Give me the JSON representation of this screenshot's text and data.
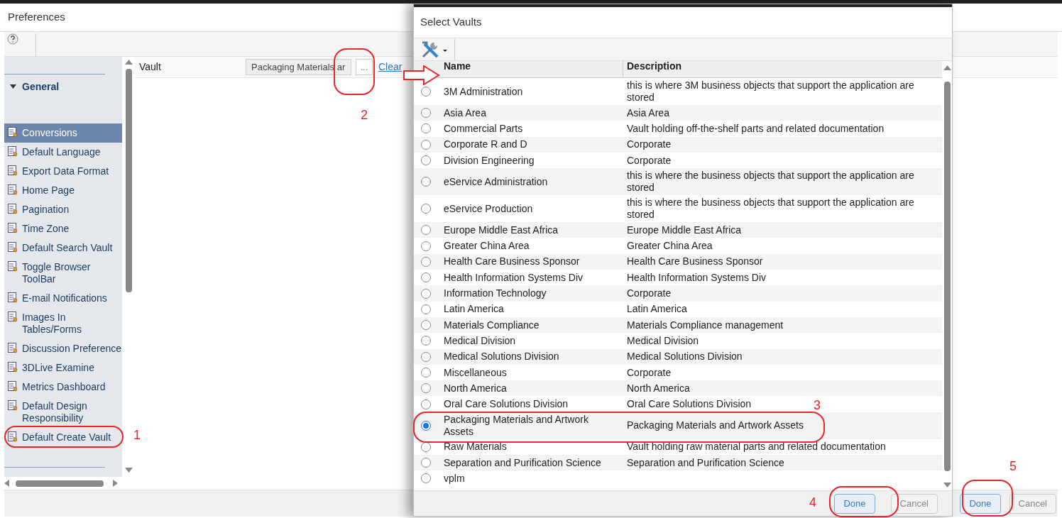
{
  "window": {
    "title": "Preferences"
  },
  "sidebar": {
    "group": {
      "label": "General",
      "expanded": true
    },
    "items": [
      {
        "label": "Conversions",
        "selected": true
      },
      {
        "label": "Default Language",
        "selected": false
      },
      {
        "label": "Export Data Format",
        "selected": false
      },
      {
        "label": "Home Page",
        "selected": false
      },
      {
        "label": "Pagination",
        "selected": false
      },
      {
        "label": "Time Zone",
        "selected": false
      },
      {
        "label": "Default Search Vault",
        "selected": false
      },
      {
        "label": "Toggle Browser ToolBar",
        "selected": false
      },
      {
        "label": "E-mail Notifications",
        "selected": false
      },
      {
        "label": "Images In Tables/Forms",
        "selected": false
      },
      {
        "label": "Discussion Preference",
        "selected": false
      },
      {
        "label": "3DLive Examine",
        "selected": false
      },
      {
        "label": "Metrics Dashboard",
        "selected": false
      },
      {
        "label": "Default Design Responsibility",
        "selected": false
      },
      {
        "label": "Default Create Vault",
        "selected": false
      }
    ]
  },
  "field": {
    "label": "Vault",
    "value": "Packaging Materials ar",
    "browse": "...",
    "clear": "Clear"
  },
  "buttons": [
    {
      "label": "Done",
      "primary": true
    },
    {
      "label": "Cancel",
      "primary": false
    }
  ],
  "dialog": {
    "title": "Select Vaults",
    "columns": [
      "Name",
      "Description"
    ],
    "rows": [
      {
        "name": "3M Administration",
        "description": "this is where 3M business objects that support the application are stored",
        "selected": false
      },
      {
        "name": "Asia Area",
        "description": "Asia Area",
        "selected": false
      },
      {
        "name": "Commercial Parts",
        "description": "Vault holding off-the-shelf parts and related documentation",
        "selected": false
      },
      {
        "name": "Corporate R and D",
        "description": "Corporate",
        "selected": false
      },
      {
        "name": "Division Engineering",
        "description": "Corporate",
        "selected": false
      },
      {
        "name": "eService Administration",
        "description": "this is where the business objects that support the application are stored",
        "selected": false
      },
      {
        "name": "eService Production",
        "description": "this is where the business objects that support the application are stored",
        "selected": false
      },
      {
        "name": "Europe Middle East Africa",
        "description": "Europe Middle East Africa",
        "selected": false
      },
      {
        "name": "Greater China Area",
        "description": "Greater China Area",
        "selected": false
      },
      {
        "name": "Health Care Business Sponsor",
        "description": "Health Care Business Sponsor",
        "selected": false
      },
      {
        "name": "Health Information Systems Div",
        "description": "Health Information Systems Div",
        "selected": false
      },
      {
        "name": "Information Technology",
        "description": "Corporate",
        "selected": false
      },
      {
        "name": "Latin America",
        "description": "Latin America",
        "selected": false
      },
      {
        "name": "Materials Compliance",
        "description": "Materials Compliance management",
        "selected": false
      },
      {
        "name": "Medical Division",
        "description": "Medical Division",
        "selected": false
      },
      {
        "name": "Medical Solutions Division",
        "description": "Medical Solutions Division",
        "selected": false
      },
      {
        "name": "Miscellaneous",
        "description": "Corporate",
        "selected": false
      },
      {
        "name": "North America",
        "description": "North America",
        "selected": false
      },
      {
        "name": "Oral Care Solutions Division",
        "description": "Oral Care Solutions Division",
        "selected": false
      },
      {
        "name": "Packaging Materials and Artwork Assets",
        "description": "Packaging Materials and Artwork Assets",
        "selected": true
      },
      {
        "name": "Raw Materials",
        "description": "Vault holding raw material parts and related documentation",
        "selected": false
      },
      {
        "name": "Separation and Purification Science",
        "description": "Separation and Purification Science",
        "selected": false
      },
      {
        "name": "vplm",
        "description": "",
        "selected": false
      }
    ],
    "buttons": [
      {
        "label": "Done",
        "primary": true
      },
      {
        "label": "Cancel",
        "primary": false
      }
    ]
  },
  "annotations": [
    "1",
    "2",
    "3",
    "4",
    "5"
  ]
}
